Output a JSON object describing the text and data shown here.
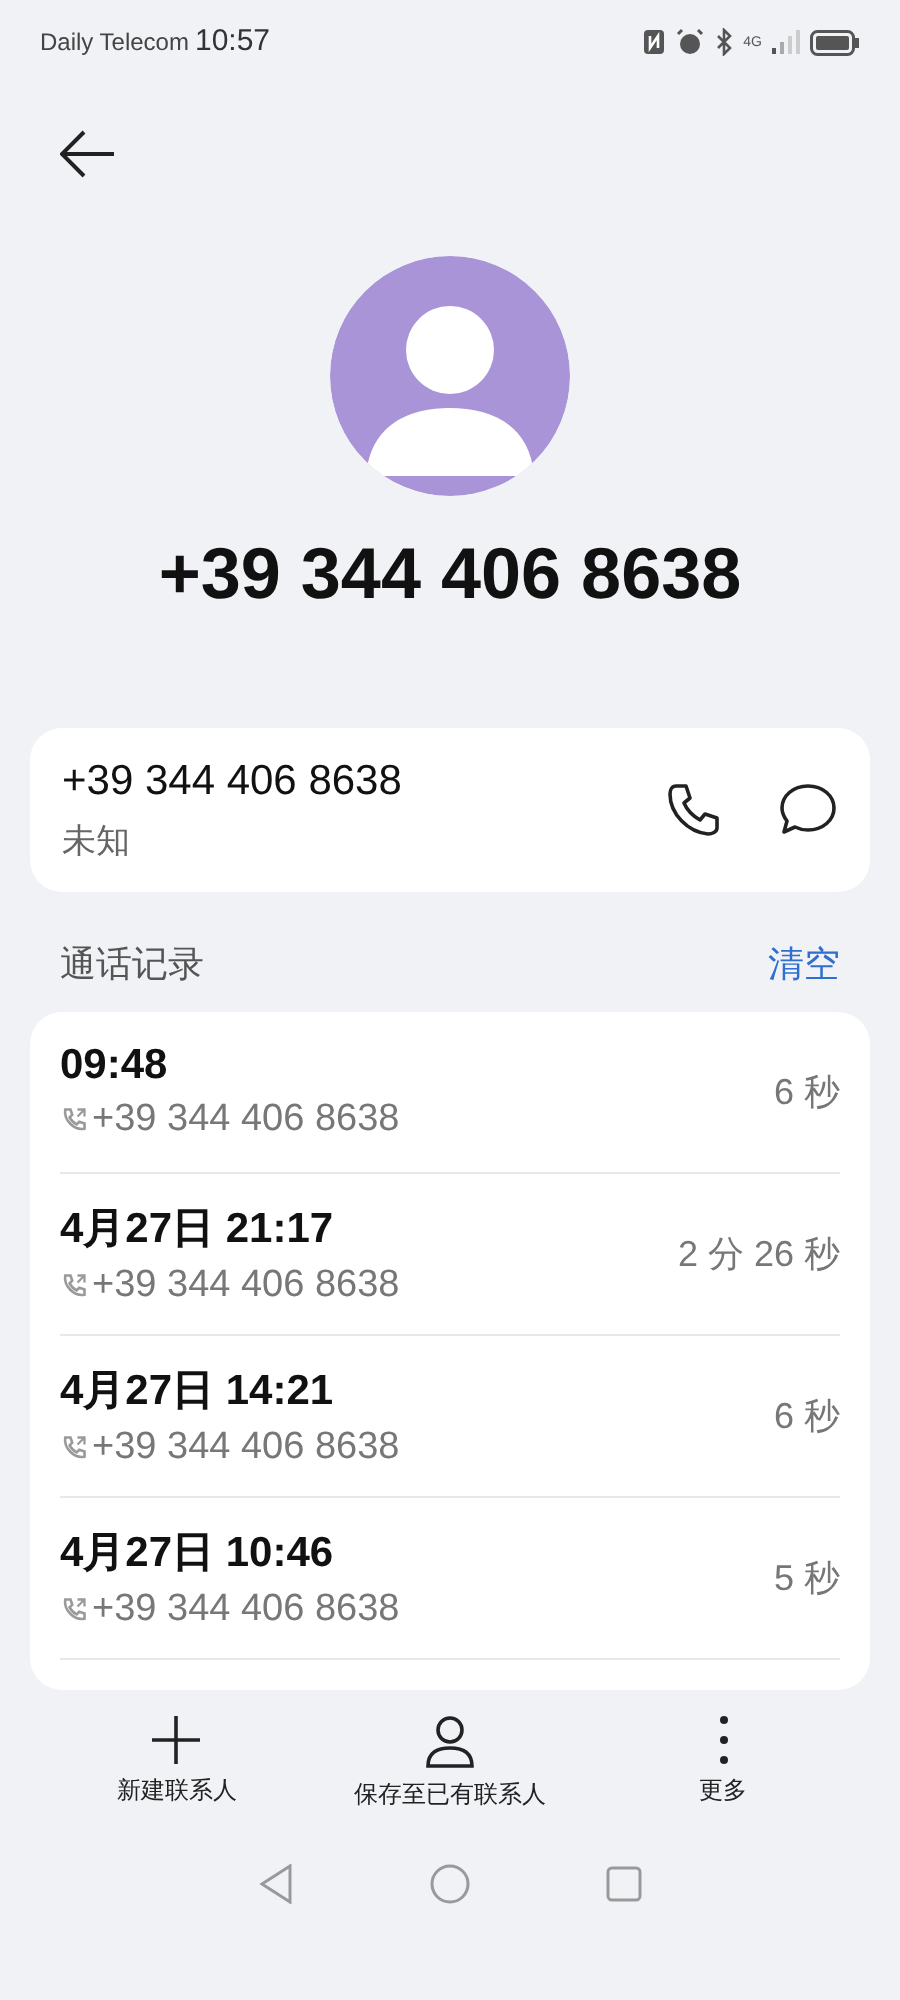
{
  "status_bar": {
    "carrier": "Daily Telecom",
    "time": "10:57",
    "network": "4G"
  },
  "contact": {
    "title": "+39 344 406 8638"
  },
  "number_card": {
    "number": "+39 344 406 8638",
    "label": "未知"
  },
  "call_log": {
    "title": "通话记录",
    "clear": "清空",
    "rows": [
      {
        "time": "09:48",
        "number": "+39 344 406 8638",
        "duration": "6 秒"
      },
      {
        "time": "4月27日 21:17",
        "number": "+39 344 406 8638",
        "duration": "2 分 26 秒"
      },
      {
        "time": "4月27日 14:21",
        "number": "+39 344 406 8638",
        "duration": "6 秒"
      },
      {
        "time": "4月27日 10:46",
        "number": "+39 344 406 8638",
        "duration": "5 秒"
      }
    ]
  },
  "actions": [
    {
      "kind": "add",
      "label": "新建联系人"
    },
    {
      "kind": "person",
      "label": "保存至已有联系人"
    },
    {
      "kind": "more",
      "label": "更多"
    }
  ]
}
